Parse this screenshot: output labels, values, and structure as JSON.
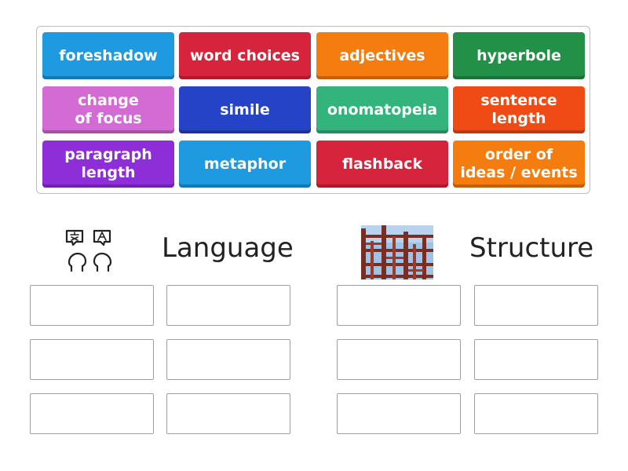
{
  "tiles": [
    {
      "label": "foreshadow",
      "color": "#1e9ae0"
    },
    {
      "label": "word choices",
      "color": "#d6243c"
    },
    {
      "label": "adjectives",
      "color": "#f57c0f"
    },
    {
      "label": "hyperbole",
      "color": "#229046"
    },
    {
      "label": "change\nof focus",
      "color": "#d46ad4"
    },
    {
      "label": "simile",
      "color": "#2443c6"
    },
    {
      "label": "onomatopeia",
      "color": "#32b47c"
    },
    {
      "label": "sentence\nlength",
      "color": "#f04b14"
    },
    {
      "label": "paragraph\nlength",
      "color": "#8e2ed8"
    },
    {
      "label": "metaphor",
      "color": "#1e9ae0"
    },
    {
      "label": "flashback",
      "color": "#d6243c"
    },
    {
      "label": "order of\nideas / events",
      "color": "#f57c0f"
    }
  ],
  "groups": [
    {
      "title": "Language",
      "icon": "translate-speech-icon"
    },
    {
      "title": "Structure",
      "icon": "steel-frame-image"
    }
  ]
}
